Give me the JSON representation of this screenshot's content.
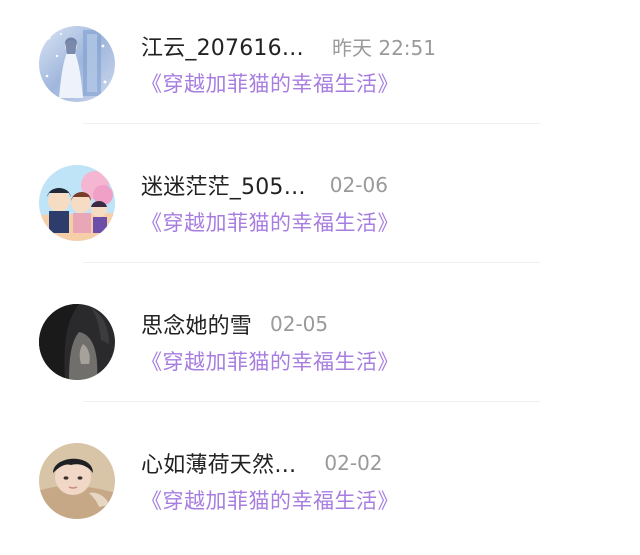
{
  "comments": [
    {
      "username": "江云_207616…",
      "time": "昨天 22:51",
      "work_title": "《穿越加菲猫的幸福生活》",
      "avatar_icon": "winter-snow-girl-avatar"
    },
    {
      "username": "迷迷茫茫_505…",
      "time": "02-06",
      "work_title": "《穿越加菲猫的幸福生活》",
      "avatar_icon": "anime-group-avatar"
    },
    {
      "username": "思念她的雪",
      "time": "02-05",
      "work_title": "《穿越加菲猫的幸福生活》",
      "avatar_icon": "dark-portrait-avatar"
    },
    {
      "username": "心如薄荷天然…",
      "time": "02-02",
      "work_title": "《穿越加菲猫的幸福生活》",
      "avatar_icon": "boy-portrait-avatar"
    }
  ],
  "colors": {
    "username": "#222222",
    "time": "#9a9a9a",
    "work_title": "#a77ee0",
    "divider": "#f0eff2"
  }
}
